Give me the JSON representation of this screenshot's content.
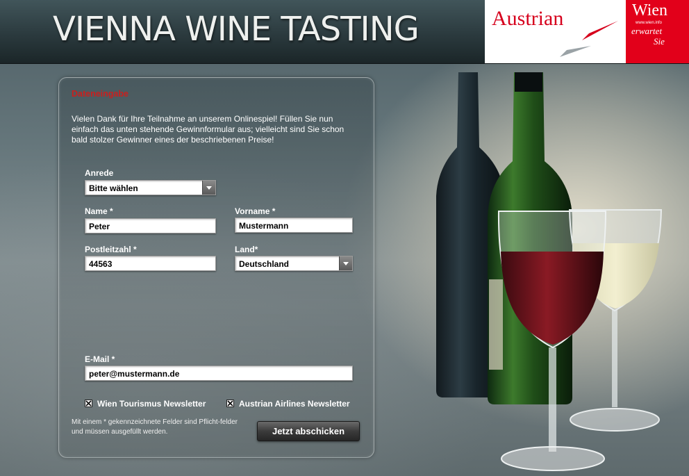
{
  "header": {
    "title": "VIENNA WINE TASTING",
    "logo_austrian": "Austrian",
    "logo_wien": "Wien",
    "logo_wien_url": "www.wien.info",
    "logo_wien_slogan_1": "erwartet",
    "logo_wien_slogan_2": "Sie"
  },
  "form": {
    "section_title": "Dateneingabe",
    "intro": "Vielen Dank für Ihre Teilnahme an unserem Onlinespiel! Füllen Sie nun einfach das unten stehende Gewinnformular aus; vielleicht sind Sie schon bald stolzer Gewinner eines der beschriebenen Preise!",
    "anrede": {
      "label": "Anrede",
      "value": "Bitte wählen"
    },
    "name": {
      "label": "Name *",
      "value": "Peter"
    },
    "vorname": {
      "label": "Vorname *",
      "value": "Mustermann"
    },
    "plz": {
      "label": "Postleitzahl *",
      "value": "44563"
    },
    "land": {
      "label": "Land*",
      "value": "Deutschland"
    },
    "email": {
      "label": "E-Mail *",
      "value": "peter@mustermann.de"
    },
    "newsletter_wien": {
      "label": "Wien Tourismus Newsletter",
      "checked": true
    },
    "newsletter_austrian": {
      "label": "Austrian Airlines Newsletter",
      "checked": true
    },
    "required_note": "Mit einem * gekennzeichnete Felder sind Pflicht-felder und müssen ausgefüllt werden.",
    "submit_label": "Jetzt abschicken"
  },
  "colors": {
    "section_title": "#c8201e",
    "austrian_red": "#d6001c",
    "wien_red": "#e2001a"
  },
  "icons": {
    "select_arrow": "chevron-down-icon",
    "checkbox_mark": "cross-mark-icon"
  }
}
